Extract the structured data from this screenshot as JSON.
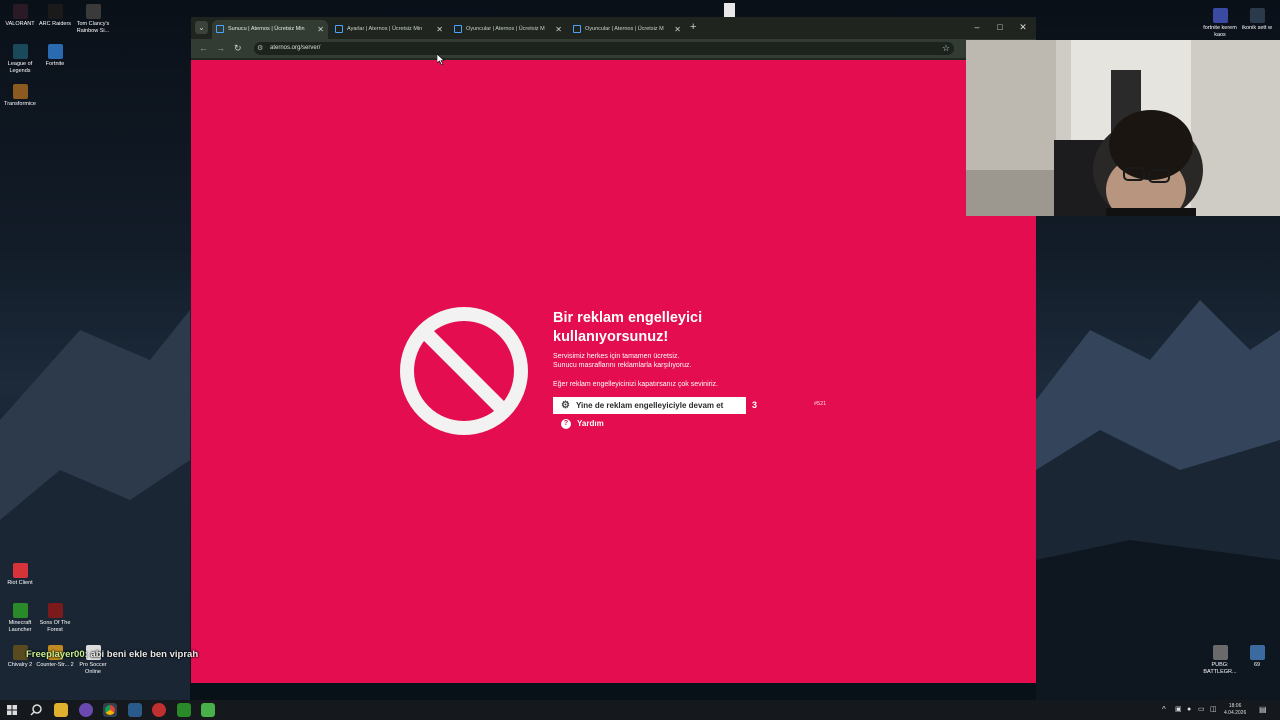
{
  "desktop": {
    "icons_left": [
      {
        "label": "VALORANT",
        "color": "#2a1a26"
      },
      {
        "label": "ARC Raiders",
        "color": "#1a1a1a"
      },
      {
        "label": "Tom Clancy's Rainbow Si...",
        "color": "#3a3a3a"
      },
      {
        "label": "League of Legends",
        "color": "#1a4a5a"
      },
      {
        "label": "Fortnite",
        "color": "#2a6ab0"
      },
      {
        "label": "Transformice",
        "color": "#8a5a20"
      },
      {
        "label": "Riot Client",
        "color": "#d6333a"
      },
      {
        "label": "Minecraft Launcher",
        "color": "#2a8a2a"
      },
      {
        "label": "Sons Of The Forest",
        "color": "#7a1a1a"
      },
      {
        "label": "Chivalry 2",
        "color": "#5a4a20"
      },
      {
        "label": "Counter-Str... 2",
        "color": "#c08a20"
      },
      {
        "label": "Pro Soccer Online",
        "color": "#dddddd"
      }
    ],
    "icons_right": [
      {
        "label": "fortnite kerem kaos",
        "color": "#3a4aa0"
      },
      {
        "label": "ikonik sett w",
        "color": "#2a3a4a"
      },
      {
        "label": "PUBG: BATTLEGR...",
        "color": "#6a6a6a"
      },
      {
        "label": "69",
        "color": "#3a6aa0"
      }
    ]
  },
  "browser": {
    "tabs": [
      {
        "label": "Sunucu | Aternos | Ücretsiz Min",
        "active": true
      },
      {
        "label": "Ayarlar | Aternos | Ücretsiz Min",
        "active": false
      },
      {
        "label": "Oyuncular | Aternos | Ücretsiz M",
        "active": false
      },
      {
        "label": "Oyuncular | Aternos | Ücretsiz M",
        "active": false
      }
    ],
    "new_tab": "+",
    "url": "aternos.org/server/",
    "window_controls": {
      "minimize": "–",
      "maximize": "□",
      "close": "✕"
    }
  },
  "page": {
    "heading_line1": "Bir reklam engelleyici",
    "heading_line2": "kullanıyorsunuz!",
    "text_line1": "Servisimiz herkes için tamamen ücretsiz.",
    "text_line2": "Sunucu masraflarını reklamlarla karşılıyoruz.",
    "text_line3": "Eğer reklam engelleyicinizi kapatırsanız çok seviniriz.",
    "continue_button": "Yine de reklam engelleyiciyle devam et",
    "countdown": "3",
    "error_code": "#521",
    "help_link": "Yardım",
    "accent_color": "#e30d4f"
  },
  "chat": {
    "username": "Freeplayer00",
    "message": ": abi beni ekle ben viprah"
  },
  "taskbar": {
    "clock_time": "18:06",
    "clock_date": "4.04.2026",
    "tray_chevron": "^"
  }
}
